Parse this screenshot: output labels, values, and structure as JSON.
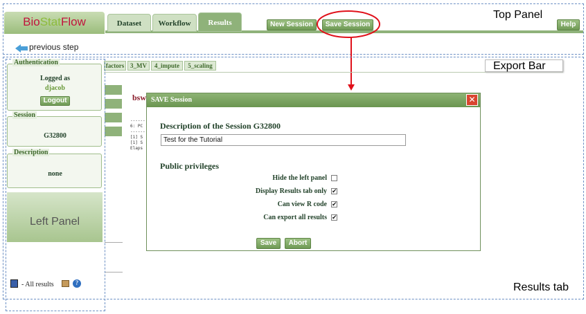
{
  "logo": {
    "part1": "Bio",
    "part2": "Stat",
    "part3": "Flow"
  },
  "tabs": [
    {
      "label": "Dataset"
    },
    {
      "label": "Workflow"
    },
    {
      "label": "Results"
    }
  ],
  "toolbar": {
    "new_session": "New Session",
    "save_session": "Save Session",
    "help": "Help"
  },
  "nav": {
    "previous_step": "previous step"
  },
  "annotations": {
    "top_panel": "Top Panel",
    "export_bar": "Export Bar",
    "left_panel": "Left Panel",
    "results_tab": "Results tab"
  },
  "export_bar": {
    "tabs": [
      "factors",
      "3_MV",
      "4_impute",
      "5_scaling"
    ]
  },
  "left": {
    "auth_legend": "Authentication",
    "logged_as": "Logged as",
    "user": "djacob",
    "logout": "Logout",
    "session_legend": "Session",
    "session_id": "G32800",
    "desc_legend": "Description",
    "desc_value": "none",
    "all_results": "- All results"
  },
  "results": {
    "title_fragment": "bsw",
    "console_lines": [
      "------",
      "6: PC",
      "------",
      "[1] S",
      "[1] S",
      "Elaps"
    ]
  },
  "modal": {
    "title": "SAVE Session",
    "close": "✕",
    "desc_heading": "Description of the Session G32800",
    "desc_value": "Test for the Tutorial",
    "privileges_heading": "Public privileges",
    "privileges": [
      {
        "label": "Hide the left panel",
        "checked": false,
        "mark": ""
      },
      {
        "label": "Display Results tab only",
        "checked": true,
        "mark": "✔"
      },
      {
        "label": "Can view R code",
        "checked": true,
        "mark": "✔"
      },
      {
        "label": "Can export all results",
        "checked": true,
        "mark": "✔"
      }
    ],
    "save": "Save",
    "abort": "Abort"
  },
  "colors": {
    "accent_green": "#8fb27a",
    "annotation_red": "#e0101a",
    "brand_red": "#c0143c"
  }
}
